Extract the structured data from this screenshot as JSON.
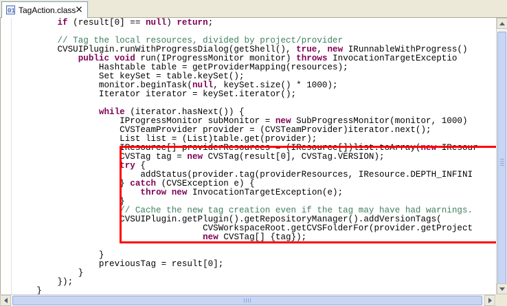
{
  "tab": {
    "label": "TagAction.class",
    "close_glyph": "×",
    "icon": "class-file-icon"
  },
  "code_lines": [
    [
      {
        "t": "        "
      },
      {
        "t": "if",
        "c": "kw"
      },
      {
        "t": " (result[0] == "
      },
      {
        "t": "null",
        "c": "kw"
      },
      {
        "t": ") "
      },
      {
        "t": "return",
        "c": "kw"
      },
      {
        "t": ";"
      }
    ],
    [
      {
        "t": ""
      }
    ],
    [
      {
        "t": "        "
      },
      {
        "t": "// Tag the local resources, divided by project/provider",
        "c": "cm"
      }
    ],
    [
      {
        "t": "        CVSUIPlugin.runWithProgressDialog(getShell(), "
      },
      {
        "t": "true",
        "c": "kw"
      },
      {
        "t": ", "
      },
      {
        "t": "new",
        "c": "kw"
      },
      {
        "t": " IRunnableWithProgress()"
      }
    ],
    [
      {
        "t": "            "
      },
      {
        "t": "public",
        "c": "kw"
      },
      {
        "t": " "
      },
      {
        "t": "void",
        "c": "kw"
      },
      {
        "t": " run(IProgressMonitor monitor) "
      },
      {
        "t": "throws",
        "c": "kw"
      },
      {
        "t": " InvocationTargetExceptio"
      }
    ],
    [
      {
        "t": "                Hashtable table = getProviderMapping(resources);"
      }
    ],
    [
      {
        "t": "                Set keySet = table.keySet();"
      }
    ],
    [
      {
        "t": "                monitor.beginTask("
      },
      {
        "t": "null",
        "c": "kw"
      },
      {
        "t": ", keySet.size() * 1000);"
      }
    ],
    [
      {
        "t": "                Iterator iterator = keySet.iterator();"
      }
    ],
    [
      {
        "t": ""
      }
    ],
    [
      {
        "t": "                "
      },
      {
        "t": "while",
        "c": "kw"
      },
      {
        "t": " (iterator.hasNext()) {"
      }
    ],
    [
      {
        "t": "                    IProgressMonitor subMonitor = "
      },
      {
        "t": "new",
        "c": "kw"
      },
      {
        "t": " SubProgressMonitor(monitor, 1000)"
      }
    ],
    [
      {
        "t": "                    CVSTeamProvider provider = (CVSTeamProvider)iterator.next();"
      }
    ],
    [
      {
        "t": "                    List list = (List)table.get(provider);"
      }
    ],
    [
      {
        "t": "                    IResource[] providerResources = (IResource[])list.toArray("
      },
      {
        "t": "new",
        "c": "kw"
      },
      {
        "t": " IResour"
      }
    ],
    [
      {
        "t": "                    CVSTag tag = "
      },
      {
        "t": "new",
        "c": "kw"
      },
      {
        "t": " CVSTag(result[0], CVSTag.VERSION);"
      }
    ],
    [
      {
        "t": "                    "
      },
      {
        "t": "try",
        "c": "kw"
      },
      {
        "t": " {"
      }
    ],
    [
      {
        "t": "                        addStatus(provider.tag(providerResources, IResource.DEPTH_INFINI"
      }
    ],
    [
      {
        "t": "                    } "
      },
      {
        "t": "catch",
        "c": "kw"
      },
      {
        "t": " (CVSException e) {"
      }
    ],
    [
      {
        "t": "                        "
      },
      {
        "t": "throw",
        "c": "kw"
      },
      {
        "t": " "
      },
      {
        "t": "new",
        "c": "kw"
      },
      {
        "t": " InvocationTargetException(e);"
      }
    ],
    [
      {
        "t": "                    }"
      }
    ],
    [
      {
        "t": "                    "
      },
      {
        "t": "// Cache the new tag creation even if the tag may have had warnings.",
        "c": "cm"
      }
    ],
    [
      {
        "t": "                    CVSUIPlugin.getPlugin().getRepositoryManager().addVersionTags("
      }
    ],
    [
      {
        "t": "                                    CVSWorkspaceRoot.getCVSFolderFor(provider.getProject"
      }
    ],
    [
      {
        "t": "                                    "
      },
      {
        "t": "new",
        "c": "kw"
      },
      {
        "t": " CVSTag[] {tag});"
      }
    ],
    [
      {
        "t": ""
      }
    ],
    [
      {
        "t": "                }"
      }
    ],
    [
      {
        "t": "                previousTag = result[0];"
      }
    ],
    [
      {
        "t": "            }"
      }
    ],
    [
      {
        "t": "        });"
      }
    ],
    [
      {
        "t": "    }"
      }
    ]
  ],
  "colors": {
    "keyword": "#7f0055",
    "comment": "#3f7f5f",
    "highlight_box": "#ff0000"
  }
}
